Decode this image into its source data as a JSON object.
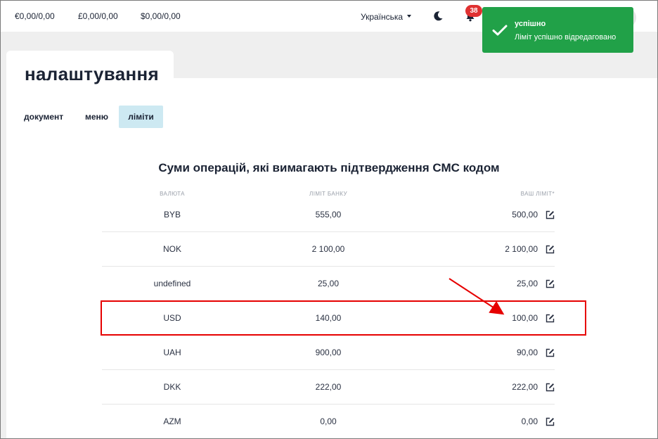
{
  "topbar": {
    "balances": [
      "€0,00/0,00",
      "£0,00/0,00",
      "$0,00/0,00"
    ],
    "language": "Українська",
    "notifications_count": "38",
    "icons": [
      "moon-icon",
      "bell-icon",
      "chevron-down-icon"
    ]
  },
  "toast": {
    "title": "успішно",
    "message": "Ліміт успішно відредаговано",
    "color": "#21a148"
  },
  "page": {
    "title": "налаштування",
    "tabs": [
      {
        "label": "документ",
        "active": false
      },
      {
        "label": "меню",
        "active": false
      },
      {
        "label": "ліміти",
        "active": true
      }
    ]
  },
  "limits": {
    "title": "Суми операцій, які вимагають підтвердження СМС кодом",
    "headers": {
      "currency": "ВАЛЮТА",
      "bank_limit": "ЛІМІТ БАНКУ",
      "your_limit": "ВАШ ЛІМІТ*"
    },
    "rows": [
      {
        "currency": "BYB",
        "bank_limit": "555,00",
        "your_limit": "500,00"
      },
      {
        "currency": "NOK",
        "bank_limit": "2 100,00",
        "your_limit": "2 100,00"
      },
      {
        "currency": "undefined",
        "bank_limit": "25,00",
        "your_limit": "25,00"
      },
      {
        "currency": "USD",
        "bank_limit": "140,00",
        "your_limit": "100,00"
      },
      {
        "currency": "UAH",
        "bank_limit": "900,00",
        "your_limit": "90,00"
      },
      {
        "currency": "DKK",
        "bank_limit": "222,00",
        "your_limit": "222,00"
      },
      {
        "currency": "AZM",
        "bank_limit": "0,00",
        "your_limit": "0,00"
      }
    ]
  },
  "annotation": {
    "highlight_color": "#e60000",
    "highlighted_row": "USD"
  }
}
